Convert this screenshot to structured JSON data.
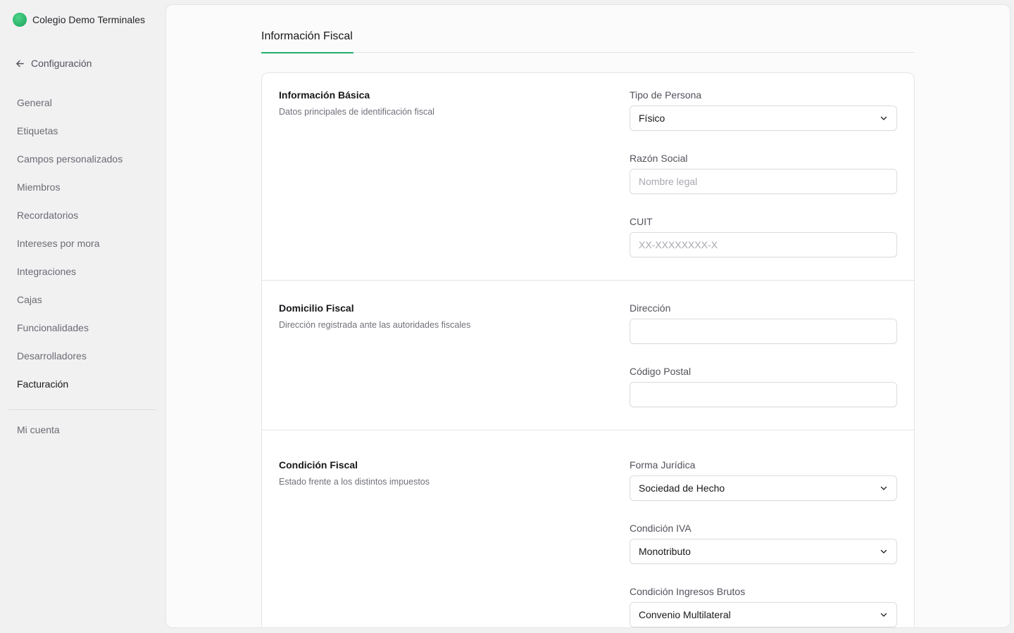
{
  "sidebar": {
    "org_name": "Colegio Demo Terminales",
    "back_label": "Configuración",
    "items": [
      {
        "label": "General"
      },
      {
        "label": "Etiquetas"
      },
      {
        "label": "Campos personalizados"
      },
      {
        "label": "Miembros"
      },
      {
        "label": "Recordatorios"
      },
      {
        "label": "Intereses por mora"
      },
      {
        "label": "Integraciones"
      },
      {
        "label": "Cajas"
      },
      {
        "label": "Funcionalidades"
      },
      {
        "label": "Desarrolladores"
      },
      {
        "label": "Facturación"
      }
    ],
    "active_item": "Facturación",
    "account_label": "Mi cuenta"
  },
  "main": {
    "tab_label": "Información Fiscal",
    "accent_color": "#1eb06a",
    "sections": [
      {
        "title": "Información Básica",
        "description": "Datos principales de identificación fiscal",
        "fields": [
          {
            "label": "Tipo de Persona",
            "type": "select",
            "value": "Físico"
          },
          {
            "label": "Razón Social",
            "type": "input",
            "value": "",
            "placeholder": "Nombre legal"
          },
          {
            "label": "CUIT",
            "type": "input",
            "value": "",
            "placeholder": "XX-XXXXXXXX-X"
          }
        ]
      },
      {
        "title": "Domicilio Fiscal",
        "description": "Dirección registrada ante las autoridades fiscales",
        "fields": [
          {
            "label": "Dirección",
            "type": "input",
            "value": "",
            "placeholder": ""
          },
          {
            "label": "Código Postal",
            "type": "input",
            "value": "",
            "placeholder": ""
          }
        ]
      },
      {
        "title": "Condición Fiscal",
        "description": "Estado frente a los distintos impuestos",
        "fields": [
          {
            "label": "Forma Jurídica",
            "type": "select",
            "value": "Sociedad de Hecho"
          },
          {
            "label": "Condición IVA",
            "type": "select",
            "value": "Monotributo"
          },
          {
            "label": "Condición Ingresos Brutos",
            "type": "select",
            "value": "Convenio Multilateral"
          }
        ]
      }
    ]
  }
}
